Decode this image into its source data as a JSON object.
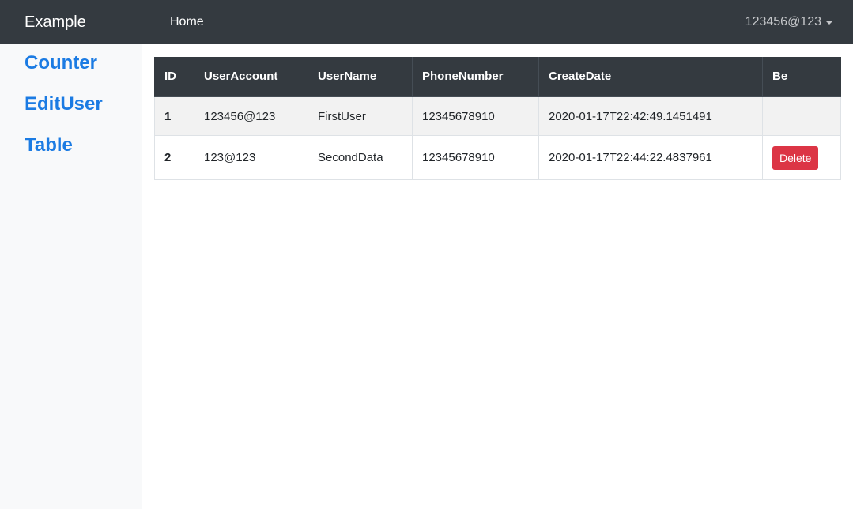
{
  "navbar": {
    "brand": "Example",
    "links": [
      {
        "label": "Home"
      }
    ],
    "user": "123456@123"
  },
  "sidebar": {
    "items": [
      {
        "label": "Counter"
      },
      {
        "label": "EditUser"
      },
      {
        "label": "Table"
      }
    ]
  },
  "table": {
    "headers": [
      "ID",
      "UserAccount",
      "UserName",
      "PhoneNumber",
      "CreateDate",
      "Be"
    ],
    "rows": [
      {
        "id": "1",
        "account": "123456@123",
        "name": "FirstUser",
        "phone": "12345678910",
        "created": "2020-01-17T22:42:49.1451491",
        "action": ""
      },
      {
        "id": "2",
        "account": "123@123",
        "name": "SecondData",
        "phone": "12345678910",
        "created": "2020-01-17T22:44:22.4837961",
        "action": "Delete"
      }
    ]
  },
  "colors": {
    "navbar_bg": "#343a40",
    "link": "#1b7be3",
    "danger": "#dc3545",
    "sidebar_bg": "#f8f9fa"
  }
}
